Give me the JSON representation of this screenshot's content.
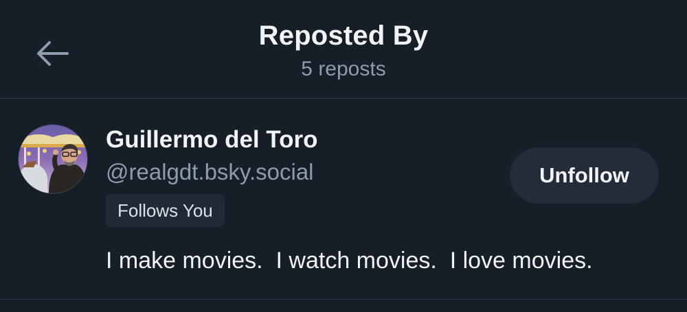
{
  "header": {
    "title": "Reposted By",
    "subtitle": "5 reposts",
    "back_icon": "arrow-left-icon"
  },
  "user": {
    "name": "Guillermo del Toro",
    "handle": "@realgdt.bsky.social",
    "badge": "Follows You",
    "bio": "I make movies.  I watch movies.  I love movies.",
    "follow_button_label": "Unfollow"
  },
  "colors": {
    "background": "#161e27",
    "text_primary": "#f1f3f5",
    "text_secondary": "#8f9cac",
    "button_bg": "#222d39",
    "badge_bg": "#1f2a36",
    "divider": "#2e3a47"
  }
}
